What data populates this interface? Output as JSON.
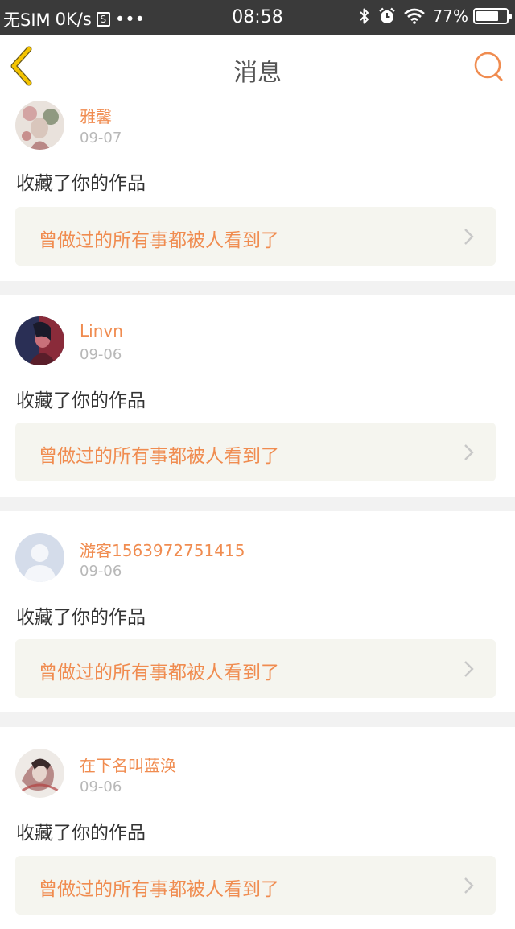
{
  "status_bar": {
    "carrier": "无SIM",
    "speed": "0K/s",
    "sim_icon_letter": "S",
    "more": "•••",
    "time": "08:58",
    "battery_percent": "77%",
    "battery_level": 0.77
  },
  "nav": {
    "title": "消息"
  },
  "colors": {
    "accent": "#f08c50",
    "back_icon": "#f5c400",
    "status_bar_bg": "#3a3a3a",
    "card_bg": "#ffffff",
    "work_bg": "#f5f5ef",
    "divider_bg": "#f2f2f2"
  },
  "messages": [
    {
      "username": "雅馨",
      "date": "09-07",
      "action": "收藏了你的作品",
      "work_title": "曾做过的所有事都被人看到了",
      "avatar": "floral-portrait-avatar"
    },
    {
      "username": "Linvn",
      "date": "09-06",
      "action": "收藏了你的作品",
      "work_title": "曾做过的所有事都被人看到了",
      "avatar": "dark-red-portrait-avatar"
    },
    {
      "username": "游客1563972751415",
      "date": "09-06",
      "action": "收藏了你的作品",
      "work_title": "曾做过的所有事都被人看到了",
      "avatar": "default-user-avatar"
    },
    {
      "username": "在下名叫蓝涣",
      "date": "09-06",
      "action": "收藏了你的作品",
      "work_title": "曾做过的所有事都被人看到了",
      "avatar": "ink-painting-avatar"
    }
  ]
}
